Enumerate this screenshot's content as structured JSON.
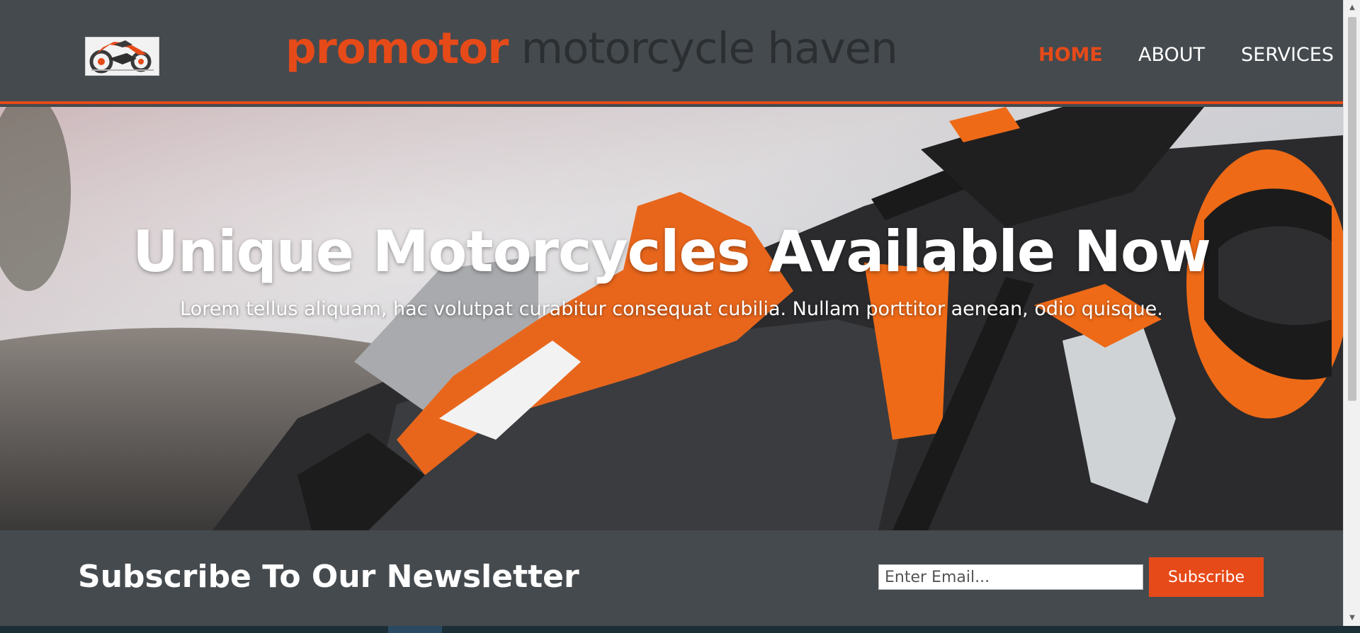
{
  "header": {
    "logo_name": "motorcycle-logo",
    "brand_part1": "promotor",
    "brand_part2": "motorcycle haven",
    "nav": [
      {
        "label": "HOME",
        "active": true
      },
      {
        "label": "ABOUT",
        "active": false
      },
      {
        "label": "SERVICES",
        "active": false
      }
    ]
  },
  "hero": {
    "title": "Unique Motorcycles Available Now",
    "subtitle": "Lorem tellus aliquam, hac volutpat curabitur consequat cubilia. Nullam porttitor aenean, odio quisque."
  },
  "newsletter": {
    "title": "Subscribe To Our Newsletter",
    "email_placeholder": "Enter Email...",
    "button_label": "Subscribe"
  },
  "colors": {
    "accent": "#e64a19",
    "background": "#454a4e",
    "text_light": "#ffffff",
    "brand_dark": "#2c2f31"
  }
}
